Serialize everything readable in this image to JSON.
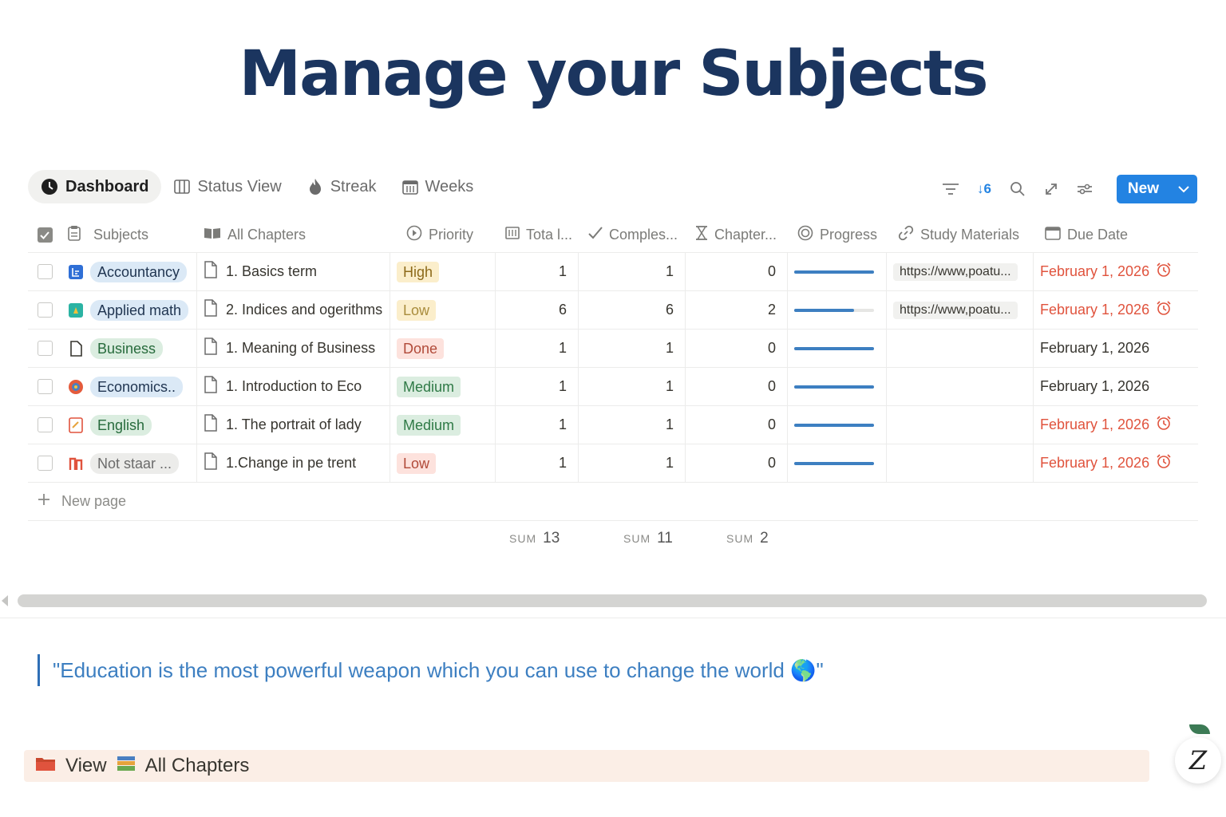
{
  "title": "Manage your Subjects",
  "tabs": [
    {
      "label": "Dashboard",
      "icon": "dashboard-icon"
    },
    {
      "label": "Status View",
      "icon": "board-icon"
    },
    {
      "label": "Streak",
      "icon": "flame-icon"
    },
    {
      "label": "Weeks",
      "icon": "calendar-icon"
    }
  ],
  "toolbar": {
    "sort_label": "↓6",
    "new_label": "New"
  },
  "columns": {
    "subjects": "Subjects",
    "chapters": "All Chapters",
    "priority": "Priority",
    "total": "Tota l...",
    "completed": "Comples...",
    "chapters_left": "Chapter...",
    "progress": "Progress",
    "materials": "Study Materials",
    "due": "Due Date"
  },
  "rows": [
    {
      "subject": "Accountancy",
      "chapter": "1. Basics term",
      "priority": "High",
      "total": "1",
      "completed": "1",
      "left": "0",
      "progress": 1.0,
      "material": "https://www,poatu...",
      "due": "February 1, 2026",
      "overdue": true
    },
    {
      "subject": "Applied math",
      "chapter": "2. Indices and ogerithms",
      "priority": "Low",
      "total": "6",
      "completed": "6",
      "left": "2",
      "progress": 0.75,
      "material": "https://www,poatu...",
      "due": "February 1, 2026",
      "overdue": true
    },
    {
      "subject": "Business",
      "chapter": "1. Meaning of Business",
      "priority": "Done",
      "total": "1",
      "completed": "1",
      "left": "0",
      "progress": 1.0,
      "material": "",
      "due": "February 1, 2026",
      "overdue": false
    },
    {
      "subject": "Economics..",
      "chapter": "1. Introduction to Eco",
      "priority": "Medium",
      "total": "1",
      "completed": "1",
      "left": "0",
      "progress": 1.0,
      "material": "",
      "due": "February 1, 2026",
      "overdue": false
    },
    {
      "subject": "English",
      "chapter": "1. The portrait of lady",
      "priority": "Medium",
      "total": "1",
      "completed": "1",
      "left": "0",
      "progress": 1.0,
      "material": "",
      "due": "February 1, 2026",
      "overdue": true
    },
    {
      "subject": "Not staar ...",
      "chapter": "1.Change in pe trent",
      "priority": "Low",
      "total": "1",
      "completed": "1",
      "left": "0",
      "progress": 1.0,
      "material": "",
      "due": "February 1, 2026",
      "overdue": true
    }
  ],
  "new_page": "New page",
  "sums": [
    {
      "label": "SUM",
      "value": "13"
    },
    {
      "label": "SUM",
      "value": "11"
    },
    {
      "label": "SUM",
      "value": "2"
    }
  ],
  "quote": "\"Education is the most powerful weapon which you can use to change the world 🌎\"",
  "callout": {
    "view": "View",
    "target": "All Chapters"
  },
  "fab_label": "Z",
  "colors": {
    "title": "#1b355f",
    "accent": "#2383e2",
    "overdue": "#e0533d",
    "progress": "#3d7fc1"
  }
}
